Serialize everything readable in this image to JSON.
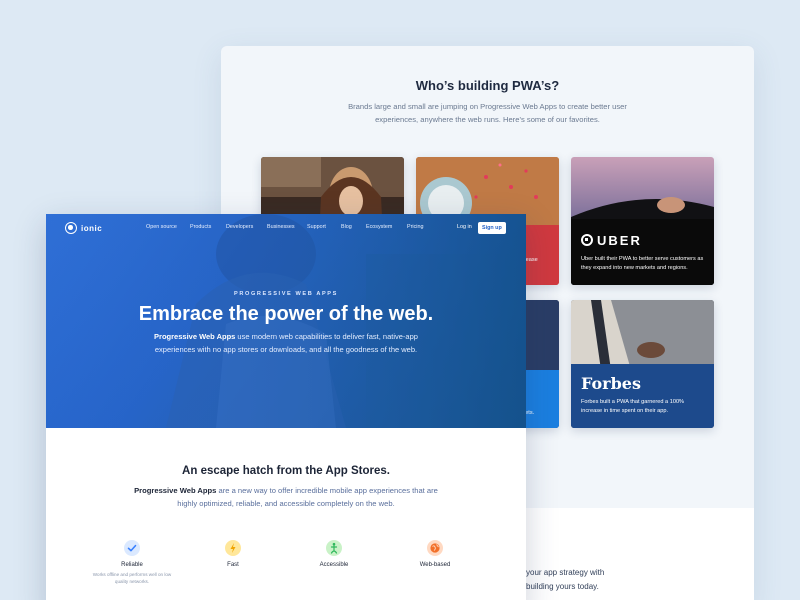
{
  "showcase": {
    "title": "Who’s building PWA’s?",
    "description": "Brands large and small are jumping on Progressive Web Apps to create better user experiences, anywhere the web runs. Here’s some of our favorites.",
    "tiles": [
      {
        "brand": "",
        "caption": ""
      },
      {
        "brand": "",
        "caption": "rcease"
      },
      {
        "brand": "UBER",
        "caption": "Uber built their PWA to better serve customers as they expand into new markets and regions."
      },
      {
        "brand": "",
        "caption": "ir\nweets."
      },
      {
        "brand": "Forbes",
        "caption": "Forbes built a PWA that garnered a 100% increase in time spent on their app."
      }
    ],
    "bottom_text_line1": "your app strategy with",
    "bottom_text_line2": "building yours today."
  },
  "nav": {
    "brand": "ionic",
    "links": [
      "Open source",
      "Products",
      "Developers",
      "Businesses",
      "Support",
      "Blog",
      "Ecosystem",
      "Pricing"
    ],
    "login": "Log in",
    "signup": "Sign up"
  },
  "hero": {
    "kicker": "PROGRESSIVE WEB APPS",
    "title": "Embrace the power of the web.",
    "desc_bold": "Progressive Web Apps",
    "desc_rest": " use modern web capabilities to deliver fast, native-app experiences with no app stores or downloads, and all the goodness of the web."
  },
  "escape": {
    "title": "An escape hatch from the App Stores.",
    "desc_bold": "Progressive Web Apps",
    "desc_rest": " are a new way to offer incredible mobile app experiences that are highly optimized, reliable, and accessible completely on the web."
  },
  "features": [
    {
      "name": "Reliable",
      "sub": "Works offline and performs well on low quality networks.",
      "icon": "check-icon"
    },
    {
      "name": "Fast",
      "sub": "",
      "icon": "lightning-icon"
    },
    {
      "name": "Accessible",
      "sub": "",
      "icon": "accessibility-icon"
    },
    {
      "name": "Web-based",
      "sub": "",
      "icon": "globe-icon"
    }
  ],
  "colors": {
    "ionic_blue": "#3880ff",
    "hero_deep": "#155287",
    "uber_tile": "#0a0a0a",
    "forbes_tile": "#1d4a8c",
    "red_tile": "#d0393f",
    "blue_tile": "#1b7fe0"
  }
}
